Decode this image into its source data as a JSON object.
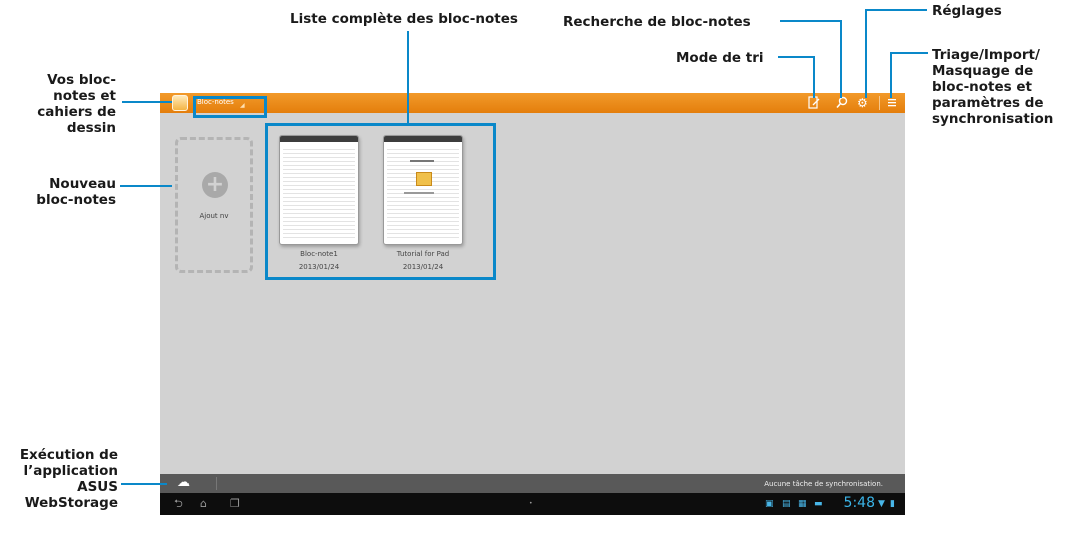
{
  "annotations": {
    "vos_bloc_notes": "Vos bloc-\nnotes et\ncahiers de\ndessin",
    "nouveau": "Nouveau\nbloc-notes",
    "execution": "Exécution de\nl’application\nASUS\nWebStorage",
    "liste": "Liste complète des bloc-notes",
    "recherche": "Recherche de bloc-notes",
    "mode_tri": "Mode de tri",
    "reglages": "Réglages",
    "triage": "Triage/Import/\nMasquage de\nbloc-notes et\nparamètres de\nsynchronisation"
  },
  "app": {
    "dropdown_label": "Bloc-notes",
    "add_label": "Ajout nv",
    "notebooks": [
      {
        "name": "Bloc-note1",
        "date": "2013/01/24"
      },
      {
        "name": "Tutorial for Pad",
        "date": "2013/01/24"
      }
    ],
    "sync_status": "Aucune tâche de synchronisation.",
    "clock": "5:48"
  },
  "icons": {
    "sort": "sort-mode-icon",
    "search": "search-icon",
    "settings": "gear-icon",
    "menu": "menu-icon",
    "cloud": "cloud-icon",
    "back": "back-icon",
    "home": "home-icon",
    "recent": "recent-apps-icon"
  },
  "colors": {
    "accent": "#0a88c9",
    "topbar": "#ee8e1c",
    "canvas": "#d2d2d2",
    "clock": "#3ab4e7"
  }
}
